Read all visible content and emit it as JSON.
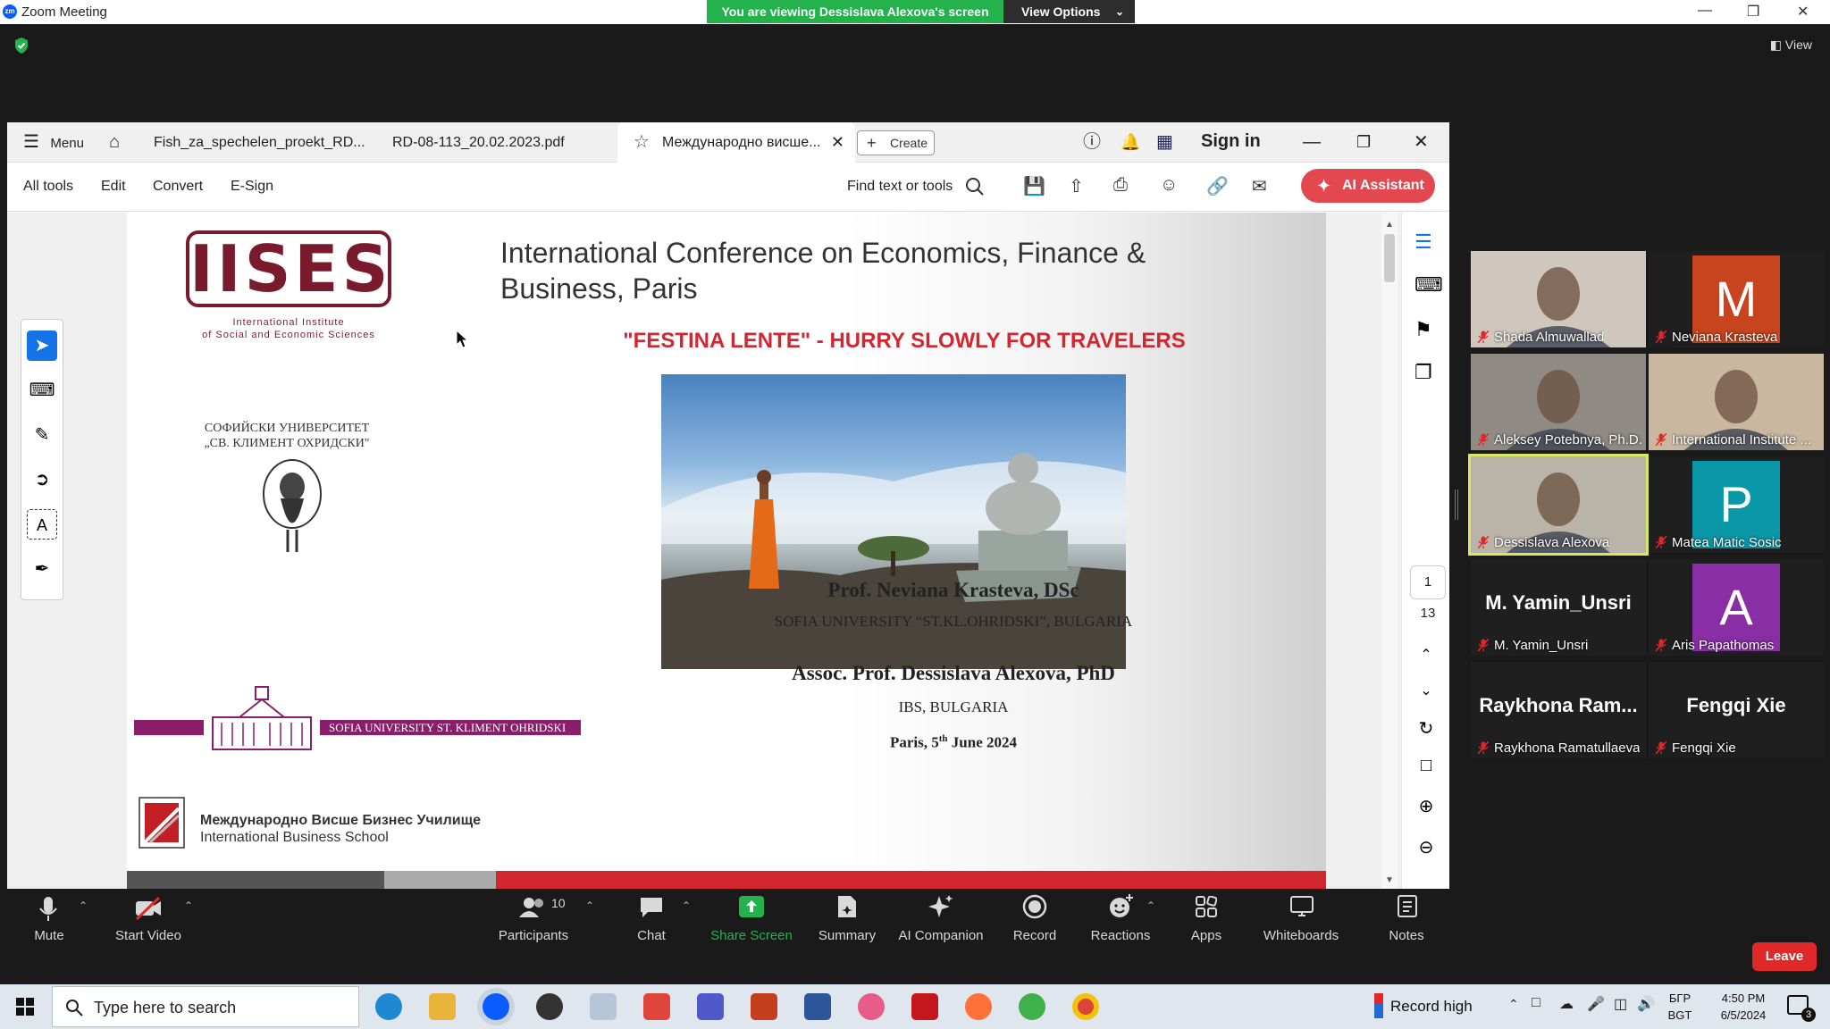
{
  "window": {
    "title": "Zoom Meeting",
    "logo_text": "zm"
  },
  "share_banner": {
    "viewing": "You are viewing Dessislava Alexova's screen",
    "view_options": "View Options"
  },
  "top_right": {
    "view": "View"
  },
  "acrobat": {
    "menu": "Menu",
    "tabs": [
      {
        "label": "Fish_za_spechelen_proekt_RD..."
      },
      {
        "label": "RD-08-113_20.02.2023.pdf"
      },
      {
        "label": "Международно висше..."
      }
    ],
    "create": "Create",
    "sign_in": "Sign in",
    "toolbar": {
      "all_tools": "All tools",
      "edit": "Edit",
      "convert": "Convert",
      "esign": "E-Sign",
      "find": "Find text or tools",
      "ai_assistant": "AI Assistant"
    },
    "page": {
      "current": "1",
      "total": "13"
    }
  },
  "slide": {
    "iises_logo": "IISES",
    "iises_line1": "International Institute",
    "iises_line2": "of Social and Economic Sciences",
    "sofia_line1": "СОФИЙСКИ УНИВЕРСИТЕТ",
    "sofia_line2": "„СВ. КЛИМЕНТ ОХРИДСКИ\"",
    "title": "International Conference on Economics, Finance & Business, Paris",
    "subtitle": "\"FESTINA LENTE\" - HURRY SLOWLY FOR TRAVELERS",
    "su_banner": "SOFIA UNIVERSITY ST. KLIMENT OHRIDSKI",
    "author1": "Prof. Neviana Krasteva, DSc",
    "affil1": "SOFIA UNIVERSITY “ST.KL.OHRIDSKI”, BULGARIA",
    "author2": "Assoc. Prof. Dessislava Alexova, PhD",
    "affil2": "IBS, BULGARIA",
    "date_pre": "Paris, 5",
    "date_sup": "th",
    "date_post": " June 2024",
    "ibs_line1": "Международно Висше Бизнес Училище",
    "ibs_line2": "International Business School"
  },
  "participants": [
    {
      "name": "Shada Almuwallad",
      "type": "video"
    },
    {
      "name": "Neviana Krasteva",
      "type": "avatar",
      "letter": "M",
      "color": "#c8441f"
    },
    {
      "name": "Aleksey Potebnya, Ph.D.",
      "type": "video"
    },
    {
      "name": "International Institute ...",
      "type": "video"
    },
    {
      "name": "Dessislava Alexova",
      "type": "video",
      "active": true
    },
    {
      "name": "Matea Matic Sosic",
      "type": "avatar",
      "letter": "P",
      "color": "#0a97a8"
    },
    {
      "name": "M. Yamin_Unsri",
      "type": "text",
      "big": "M. Yamin_Unsri"
    },
    {
      "name": "Aris Papathomas",
      "type": "avatar",
      "letter": "A",
      "color": "#8a2ea6"
    },
    {
      "name": "Raykhona Ramatullaeva",
      "type": "text",
      "big": "Raykhona  Ram..."
    },
    {
      "name": "Fengqi Xie",
      "type": "text",
      "big": "Fengqi Xie"
    }
  ],
  "controls": {
    "mute": "Mute",
    "start_video": "Start Video",
    "participants": "Participants",
    "participants_count": "10",
    "chat": "Chat",
    "share_screen": "Share Screen",
    "summary": "Summary",
    "ai_companion": "AI Companion",
    "record": "Record",
    "reactions": "Reactions",
    "apps": "Apps",
    "whiteboards": "Whiteboards",
    "notes": "Notes",
    "leave": "Leave"
  },
  "taskbar": {
    "search_placeholder": "Type here to search",
    "record_high": "Record high",
    "lang1": "БГР",
    "lang2": "BGT",
    "time": "4:50 PM",
    "date": "6/5/2024",
    "notif_count": "3"
  },
  "colors": {
    "share_green": "#23b24c",
    "ai_red": "#e34850",
    "leave_red": "#e02828",
    "iises": "#7a1b2d",
    "subtitle_red": "#d22630",
    "su_purple": "#8b1e6b"
  }
}
